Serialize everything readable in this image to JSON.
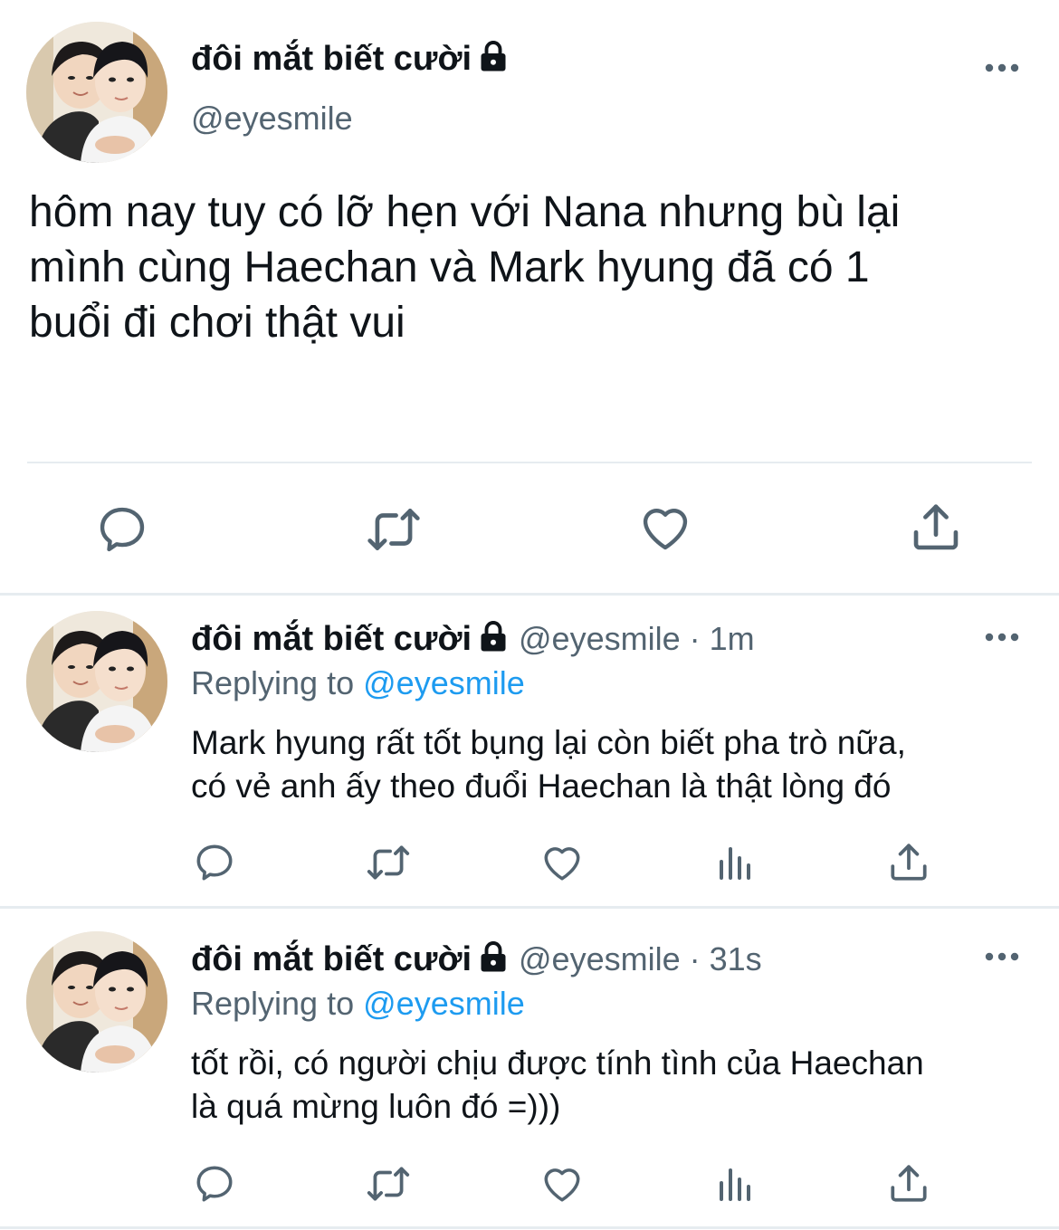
{
  "main_tweet": {
    "display_name": "đôi mắt biết cười",
    "handle": "@eyesmile",
    "text": "hôm nay tuy có lỡ hẹn với Nana nhưng bù lại\nmình cùng Haechan và Mark hyung đã có 1\nbuổi đi chơi thật vui",
    "actions": [
      "reply-icon",
      "retweet-icon",
      "like-icon",
      "share-icon"
    ]
  },
  "replies": [
    {
      "display_name": "đôi mắt biết cười",
      "handle": "@eyesmile",
      "time": "1m",
      "separator": "·",
      "replying_prefix": "Replying to",
      "replying_to": "@eyesmile",
      "text": "Mark hyung rất tốt bụng lại còn biết pha trò nữa,\ncó vẻ anh ấy theo đuổi Haechan là thật lòng đó",
      "actions": [
        "reply-icon",
        "retweet-icon",
        "like-icon",
        "analytics-icon",
        "share-icon"
      ]
    },
    {
      "display_name": "đôi mắt biết cười",
      "handle": "@eyesmile",
      "time": "31s",
      "separator": "·",
      "replying_prefix": "Replying to",
      "replying_to": "@eyesmile",
      "text": "tốt rồi, có người chịu được tính tình của Haechan\nlà quá mừng luôn đó =)))",
      "actions": [
        "reply-icon",
        "retweet-icon",
        "like-icon",
        "analytics-icon",
        "share-icon"
      ]
    }
  ],
  "colors": {
    "text": "#0f1419",
    "secondary": "#536471",
    "accent": "#1d9bf0",
    "icon": "#536471",
    "divider": "#e6ecf0"
  }
}
